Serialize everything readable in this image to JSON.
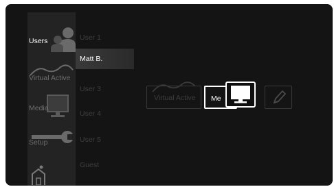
{
  "sidebar": {
    "items": [
      {
        "label": "Users",
        "icon": "users-icon"
      },
      {
        "label": "Virtual Active",
        "icon": "mountain-icon"
      },
      {
        "label": "Media",
        "icon": "monitor-icon"
      },
      {
        "label": "Setup",
        "icon": "wrench-icon"
      },
      {
        "label": "",
        "icon": "home-icon"
      }
    ]
  },
  "users": [
    "User 1",
    "Matt B.",
    "User 3",
    "User 4",
    "User 5",
    "Guest"
  ],
  "detail": {
    "virtual_active_label": "Virtual Active",
    "me_label": "Me",
    "edit_icon": "pencil-icon",
    "media_icon": "monitor-icon"
  }
}
